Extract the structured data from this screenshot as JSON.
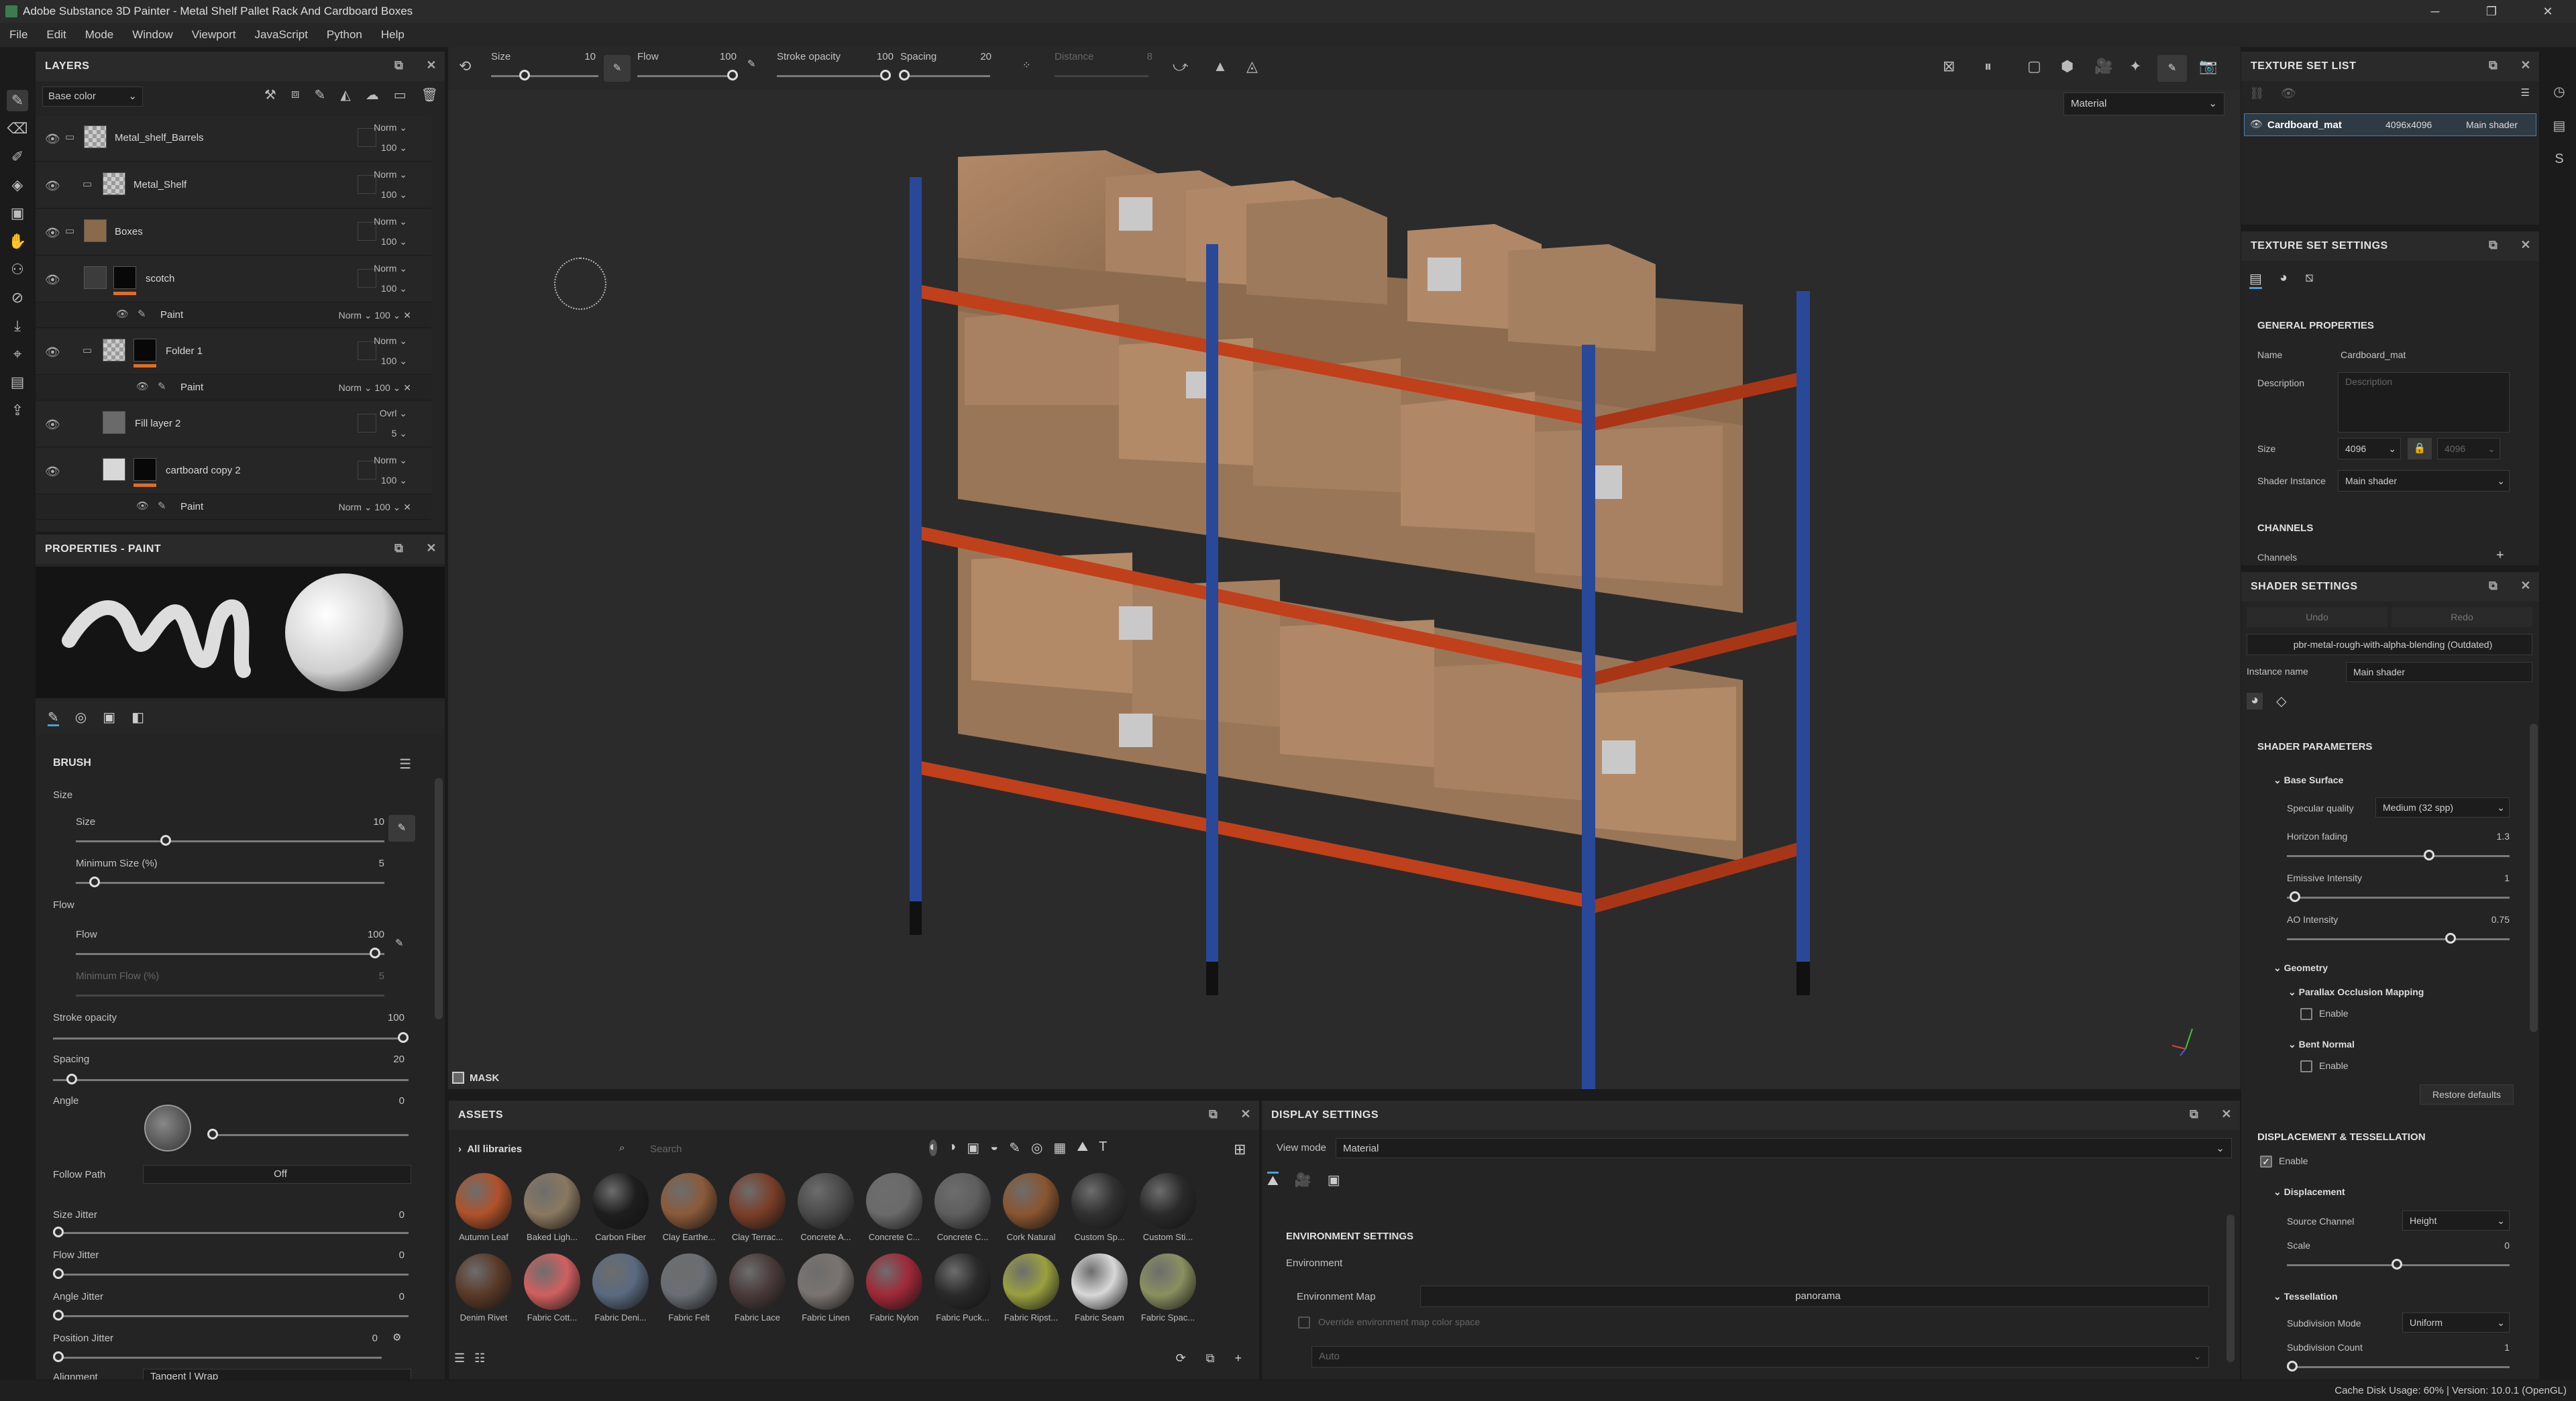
{
  "window": {
    "title": "Adobe Substance 3D Painter - Metal Shelf Pallet Rack And Cardboard Boxes"
  },
  "menu": [
    "File",
    "Edit",
    "Mode",
    "Window",
    "Viewport",
    "JavaScript",
    "Python",
    "Help"
  ],
  "toolbar": {
    "size_label": "Size",
    "size_value": "10",
    "flow_label": "Flow",
    "flow_value": "100",
    "stroke_label": "Stroke opacity",
    "stroke_value": "100",
    "spacing_label": "Spacing",
    "spacing_value": "20",
    "distance_label": "Distance",
    "distance_value": "8"
  },
  "viewport": {
    "mode_select": "Material",
    "mask_label": "MASK"
  },
  "layers": {
    "title": "LAYERS",
    "channel": "Base color",
    "rows": [
      {
        "name": "Metal_shelf_Barrels",
        "blend": "Norm",
        "opacity": "100"
      },
      {
        "name": "Metal_Shelf",
        "blend": "Norm",
        "opacity": "100"
      },
      {
        "name": "Boxes",
        "blend": "Norm",
        "opacity": "100"
      },
      {
        "name": "scotch",
        "blend": "Norm",
        "opacity": "100"
      },
      {
        "name": "Paint",
        "blend": "Norm",
        "opacity": "100"
      },
      {
        "name": "Folder 1",
        "blend": "Norm",
        "opacity": "100"
      },
      {
        "name": "Paint",
        "blend": "Norm",
        "opacity": "100"
      },
      {
        "name": "Fill layer 2",
        "blend": "Ovrl",
        "opacity": "5"
      },
      {
        "name": "cartboard copy 2",
        "blend": "Norm",
        "opacity": "100"
      },
      {
        "name": "Paint",
        "blend": "Norm",
        "opacity": "100"
      }
    ]
  },
  "properties": {
    "title": "PROPERTIES - PAINT",
    "brush": "BRUSH",
    "size_group": "Size",
    "size_label": "Size",
    "size": "10",
    "minsize_label": "Minimum Size (%)",
    "minsize": "5",
    "flow_group": "Flow",
    "flow_label": "Flow",
    "flow": "100",
    "minflow_label": "Minimum Flow (%)",
    "minflow": "5",
    "stroke_label": "Stroke opacity",
    "stroke": "100",
    "spacing_label": "Spacing",
    "spacing": "20",
    "angle_label": "Angle",
    "angle": "0",
    "follow_label": "Follow Path",
    "follow": "Off",
    "sizejit_label": "Size Jitter",
    "sizejit": "0",
    "flowjit_label": "Flow Jitter",
    "flowjit": "0",
    "anglejit_label": "Angle Jitter",
    "anglejit": "0",
    "posjit_label": "Position Jitter",
    "posjit": "0",
    "align_label": "Alignment",
    "align": "Tangent | Wrap"
  },
  "assets": {
    "title": "ASSETS",
    "library": "All libraries",
    "search_placeholder": "Search",
    "row1": [
      {
        "name": "Autumn Leaf",
        "color": "#b0522a"
      },
      {
        "name": "Baked Ligh...",
        "color": "#8a7860"
      },
      {
        "name": "Carbon Fiber",
        "color": "#1e1e1e"
      },
      {
        "name": "Clay Earthe...",
        "color": "#8a5a3a"
      },
      {
        "name": "Clay Terrac...",
        "color": "#7a3e28"
      },
      {
        "name": "Concrete A...",
        "color": "#4a4a4a"
      },
      {
        "name": "Concrete C...",
        "color": "#6a6a6a"
      },
      {
        "name": "Concrete C...",
        "color": "#5e5e5e"
      },
      {
        "name": "Cork Natural",
        "color": "#8a5530"
      },
      {
        "name": "Custom Sp...",
        "color": "#303030"
      },
      {
        "name": "Custom Sti...",
        "color": "#2a2a2a"
      }
    ],
    "row2": [
      {
        "name": "Denim Rivet",
        "color": "#5a3a28"
      },
      {
        "name": "Fabric Cott...",
        "color": "#d06060"
      },
      {
        "name": "Fabric Deni...",
        "color": "#5a6a80"
      },
      {
        "name": "Fabric Felt",
        "color": "#6a6e74"
      },
      {
        "name": "Fabric Lace",
        "color": "#4a3a3a"
      },
      {
        "name": "Fabric Linen",
        "color": "#7a7470"
      },
      {
        "name": "Fabric Nylon",
        "color": "#a02838"
      },
      {
        "name": "Fabric Puck...",
        "color": "#2a2a2a"
      },
      {
        "name": "Fabric Ripst...",
        "color": "#9aa040"
      },
      {
        "name": "Fabric Seam",
        "color": "#d8d8d8"
      },
      {
        "name": "Fabric Spac...",
        "color": "#8a9060"
      }
    ]
  },
  "display": {
    "title": "DISPLAY SETTINGS",
    "viewmode_label": "View mode",
    "viewmode": "Material",
    "env_title": "ENVIRONMENT SETTINGS",
    "env_label": "Environment",
    "envmap_label": "Environment Map",
    "envmap": "panorama",
    "override_label": "Override environment map color space",
    "auto": "Auto"
  },
  "texture_set_list": {
    "title": "TEXTURE SET LIST",
    "item_name": "Cardboard_mat",
    "item_res": "4096x4096",
    "item_shader": "Main shader"
  },
  "texture_set_settings": {
    "title": "TEXTURE SET SETTINGS",
    "general": "GENERAL PROPERTIES",
    "name_label": "Name",
    "name": "Cardboard_mat",
    "desc_label": "Description",
    "desc_placeholder": "Description",
    "size_label": "Size",
    "size_w": "4096",
    "size_h": "4096",
    "shader_label": "Shader Instance",
    "shader": "Main shader",
    "channels_title": "CHANNELS",
    "channels_label": "Channels"
  },
  "shader_settings": {
    "title": "SHADER SETTINGS",
    "undo": "Undo",
    "redo": "Redo",
    "shader_file": "pbr-metal-rough-with-alpha-blending (Outdated)",
    "instance_label": "Instance name",
    "instance": "Main shader",
    "params_title": "SHADER PARAMETERS",
    "base_surface": "Base Surface",
    "spec_label": "Specular quality",
    "spec": "Medium (32 spp)",
    "horizon_label": "Horizon fading",
    "horizon": "1.3",
    "emissive_label": "Emissive Intensity",
    "emissive": "1",
    "ao_label": "AO Intensity",
    "ao": "0.75",
    "geometry": "Geometry",
    "pom": "Parallax Occlusion Mapping",
    "enable1": "Enable",
    "bent": "Bent Normal",
    "enable2": "Enable",
    "restore": "Restore defaults",
    "disp_title": "DISPLACEMENT & TESSELLATION",
    "enable3": "Enable",
    "displacement": "Displacement",
    "source_label": "Source Channel",
    "source": "Height",
    "scale_label": "Scale",
    "scale": "0",
    "tess": "Tessellation",
    "submode_label": "Subdivision Mode",
    "submode": "Uniform",
    "subcount_label": "Subdivision Count",
    "subcount": "1"
  },
  "status": {
    "text": "Cache Disk Usage:  60%  |  Version: 10.0.1 (OpenGL)"
  }
}
